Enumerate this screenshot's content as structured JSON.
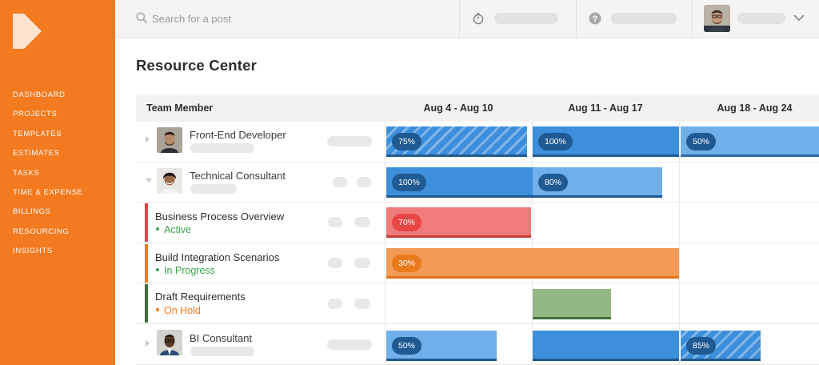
{
  "colors": {
    "brand": "#f37a1f",
    "blue_dark": "#3d8fdc",
    "blue_light": "#6fb0e8",
    "blue_badge": "#1f5a93",
    "red": "#f07b7b",
    "red_badge": "#e84545",
    "orange": "#f39a56",
    "orange_badge": "#ea7a1e",
    "green": "#93b886",
    "green_line": "#3f6f3a",
    "status_active": "#3aa54a",
    "status_progress": "#3aa54a",
    "status_hold": "#f37a1f"
  },
  "sidebar": {
    "logo_icon": "kantata-k-logo-icon",
    "items": [
      {
        "label": "DASHBOARD"
      },
      {
        "label": "PROJECTS"
      },
      {
        "label": "TEMPLATES"
      },
      {
        "label": "ESTIMATES"
      },
      {
        "label": "TASKS"
      },
      {
        "label": "TIME & EXPENSE"
      },
      {
        "label": "BILLINGS"
      },
      {
        "label": "RESOURCING"
      },
      {
        "label": "INSIGHTS"
      }
    ]
  },
  "topbar": {
    "search": {
      "placeholder": "Search for a post",
      "value": "",
      "icon": "search-icon"
    },
    "timer_icon": "stopwatch-icon",
    "help_icon": "help-icon",
    "chevron_icon": "chevron-down-icon"
  },
  "page": {
    "title": "Resource Center"
  },
  "grid": {
    "columns": [
      "Team Member",
      "Aug 4 - Aug 10",
      "Aug 11 - Aug 17",
      "Aug 18 - Aug 24"
    ],
    "rows": [
      {
        "type": "member",
        "name": "Front-End Developer",
        "allocations": [
          {
            "week": 0,
            "label": "75%",
            "value": 0.75
          },
          {
            "week": 1,
            "label": "100%",
            "value": 1.0
          },
          {
            "week": 2,
            "label": "50%",
            "value": 0.5
          }
        ]
      },
      {
        "type": "member",
        "name": "Technical Consultant",
        "allocations": [
          {
            "week": 0,
            "label": "100%",
            "value": 1.0
          },
          {
            "week": 1,
            "label": "80%",
            "value": 0.8
          }
        ]
      },
      {
        "type": "task",
        "name": "Business Process Overview",
        "status": "Active",
        "allocations": [
          {
            "week": 0,
            "label": "70%",
            "value": 0.7
          }
        ]
      },
      {
        "type": "task",
        "name": "Build Integration Scenarios",
        "status": "In Progress",
        "allocations": [
          {
            "week": 0,
            "label": "30%",
            "value": 0.3
          }
        ]
      },
      {
        "type": "task",
        "name": "Draft Requirements",
        "status": "On Hold",
        "allocations": []
      },
      {
        "type": "member",
        "name": "BI Consultant",
        "allocations": [
          {
            "week": 0,
            "label": "50%",
            "value": 0.5
          },
          {
            "week": 2,
            "label": "85%",
            "value": 0.85
          }
        ]
      }
    ]
  }
}
